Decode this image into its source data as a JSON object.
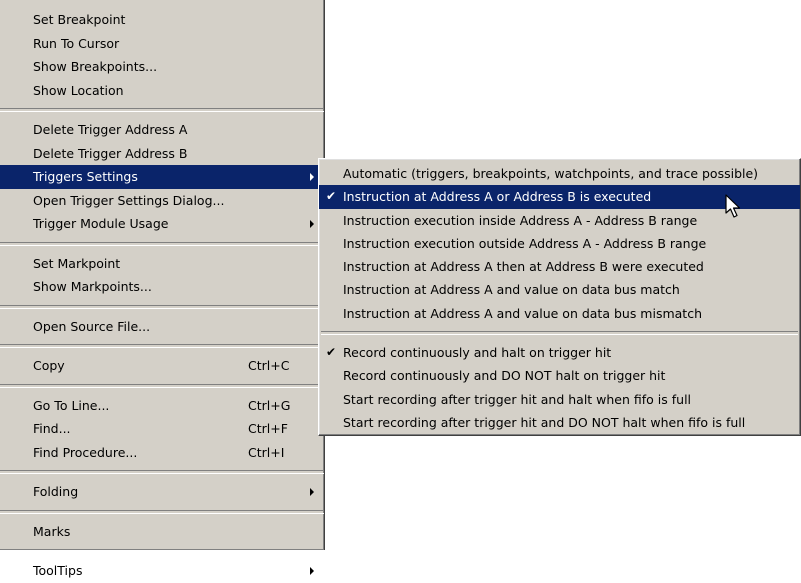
{
  "main_menu": {
    "groups": [
      [
        {
          "label": "Set Breakpoint"
        },
        {
          "label": "Run To Cursor"
        },
        {
          "label": "Show Breakpoints..."
        },
        {
          "label": "Show Location"
        }
      ],
      [
        {
          "label": "Delete Trigger Address A"
        },
        {
          "label": "Delete Trigger Address B"
        },
        {
          "label": "Triggers Settings",
          "submenu": true,
          "active": true
        },
        {
          "label": "Open Trigger Settings Dialog..."
        },
        {
          "label": "Trigger Module Usage",
          "submenu": true
        }
      ],
      [
        {
          "label": "Set Markpoint"
        },
        {
          "label": "Show Markpoints..."
        }
      ],
      [
        {
          "label": "Open Source File..."
        }
      ],
      [
        {
          "label": "Copy",
          "shortcut": "Ctrl+C"
        }
      ],
      [
        {
          "label": "Go To Line...",
          "shortcut": "Ctrl+G"
        },
        {
          "label": "Find...",
          "shortcut": "Ctrl+F"
        },
        {
          "label": "Find Procedure...",
          "shortcut": "Ctrl+I"
        }
      ],
      [
        {
          "label": "Folding",
          "submenu": true
        }
      ],
      [
        {
          "label": "Marks"
        }
      ],
      [
        {
          "label": "ToolTips",
          "submenu": true
        }
      ]
    ]
  },
  "sub_menu": {
    "groups": [
      [
        {
          "label": "Automatic (triggers, breakpoints, watchpoints, and trace possible)"
        },
        {
          "label": "Instruction at Address A or Address B is executed",
          "checked": true,
          "active": true
        },
        {
          "label": "Instruction execution inside Address A - Address B range"
        },
        {
          "label": "Instruction execution outside Address A - Address B range"
        },
        {
          "label": "Instruction at Address A then at Address B were executed"
        },
        {
          "label": "Instruction at Address A and value on data bus match"
        },
        {
          "label": "Instruction at Address A and value on data bus mismatch"
        }
      ],
      [
        {
          "label": "Record continuously and halt on trigger hit",
          "checked": true
        },
        {
          "label": "Record continuously and DO NOT halt on trigger hit"
        },
        {
          "label": "Start recording after trigger hit and halt when fifo is full"
        },
        {
          "label": "Start recording after trigger hit and DO NOT halt when fifo is full"
        }
      ]
    ]
  },
  "icons": {
    "check": "checkmark-icon",
    "submenu": "submenu-arrow-icon",
    "cursor": "mouse-pointer-icon"
  },
  "colors": {
    "menu_bg": "#d4d0c8",
    "highlight": "#0a246a"
  }
}
